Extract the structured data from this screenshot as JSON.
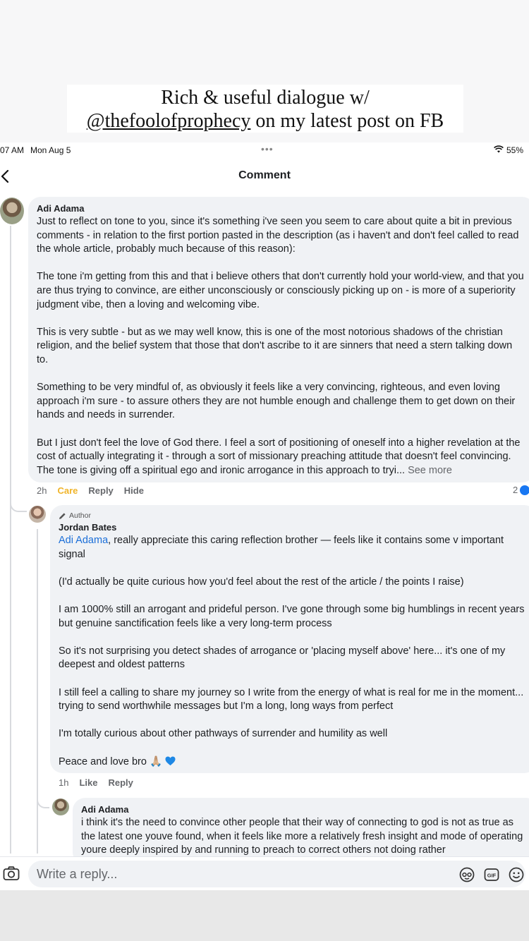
{
  "story": {
    "caption_line1": "Rich & useful dialogue w/",
    "caption_handle": "@thefoolofprophecy",
    "caption_line2_rest": " on my latest post on FB"
  },
  "status_bar": {
    "time": "07 AM",
    "date": "Mon Aug 5",
    "dots": "•••",
    "battery": "55%"
  },
  "nav": {
    "title": "Comment"
  },
  "comments": [
    {
      "author": "Adi Adama",
      "paragraphs": [
        "Just to reflect on tone to you, since it's something i've seen you seem to care about quite a bit in previous comments - in relation to the first portion pasted in the description (as i haven't and don't feel called to read the whole article, probably much because of this reason):",
        "The tone i'm getting from this and that i believe others that don't currently hold your world-view, and that you are thus trying to convince, are either unconsciously or consciously picking up on - is more of a superiority judgment vibe, then a loving and welcoming vibe.",
        "This is very subtle - but as we may well know, this is one of the most notorious shadows of the christian religion, and the belief system that those that don't ascribe to it are sinners that need a stern talking down to.",
        "Something to be very mindful of, as obviously it feels like a very convincing, righteous, and even loving approach i'm sure - to assure others they are not humble enough and challenge them to get down on their hands and needs in surrender.",
        "But I just don't feel the love of God there. I feel a sort of positioning of oneself into a higher revelation at the cost of actually integrating it - through a sort of missionary preaching attitude that doesn't feel convincing. The tone is giving off a spiritual ego and ironic arrogance in this approach to tryi..."
      ],
      "see_more": "See more",
      "time": "2h",
      "reaction_label": "Care",
      "reply_label": "Reply",
      "hide_label": "Hide",
      "reaction_count": "2"
    },
    {
      "badge": "Author",
      "author": "Jordan Bates",
      "mention": "Adi Adama",
      "paragraphs": [
        ", really appreciate this caring reflection brother — feels like it contains some v important signal",
        "(I'd actually be quite curious how you'd feel about the rest of the article / the points I raise)",
        "I am 1000% still an arrogant and prideful person. I've gone through some big humblings in recent years but genuine sanctification feels like a very long-term process",
        "So it's not surprising you detect shades of arrogance or 'placing myself above' here... it's one of my deepest and oldest patterns",
        "I still feel a calling to share my journey so I write from the energy of what is real for me in the moment... trying to send worthwhile messages but I'm a long, long ways from perfect",
        "I'm totally curious about other pathways of surrender and humility as well",
        "Peace and love bro 🙏🏼"
      ],
      "time": "1h",
      "like_label": "Like",
      "reply_label": "Reply"
    },
    {
      "author": "Adi Adama",
      "paragraphs": [
        "i think it's the need to convince other people that their way of connecting to god is not as true as the latest one youve found, when it feels like more a relatively fresh insight and mode of operating youre deeply inspired by and running to preach to correct others not doing rather"
      ]
    }
  ],
  "composer": {
    "placeholder": "Write a reply..."
  },
  "icons": {
    "back": "chevron-left-icon",
    "wifi": "wifi-icon",
    "battery": "battery-icon",
    "camera": "camera-icon",
    "avatar_sticker": "avatar-sticker-icon",
    "gif": "gif-icon",
    "emoji": "emoji-icon"
  },
  "colors": {
    "care": "#f0b429",
    "mention": "#1a6ed8",
    "bubble": "#f0f2f5",
    "like": "#1877f2"
  }
}
